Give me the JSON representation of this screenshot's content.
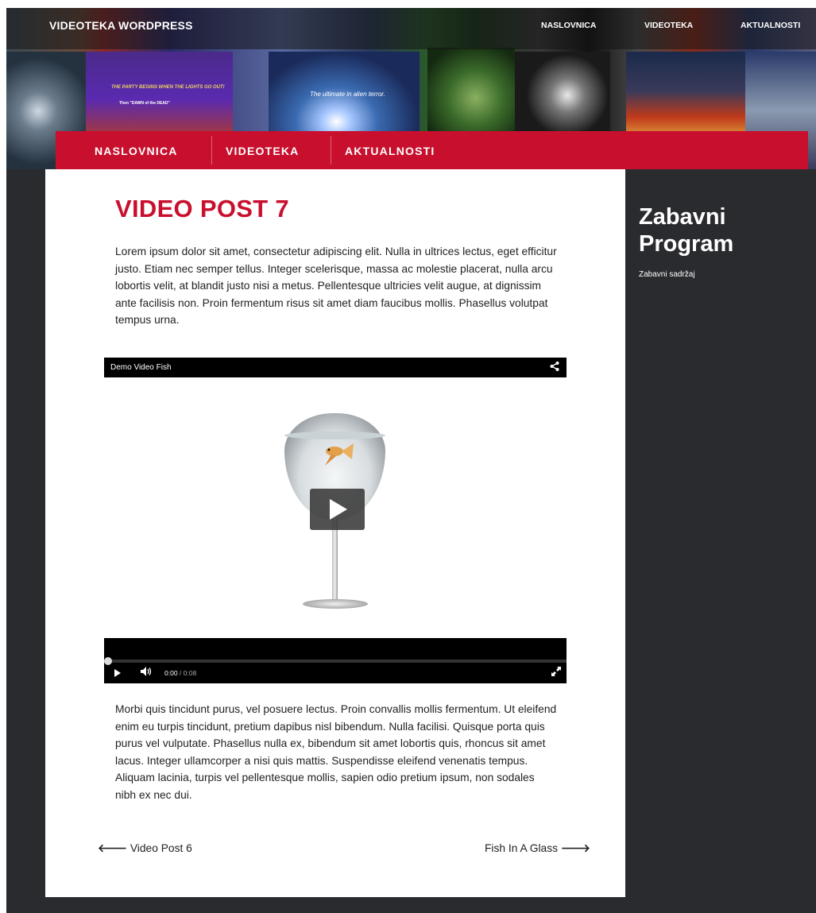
{
  "header": {
    "site_title": "VIDEOTEKA WORDPRESS",
    "top_nav": [
      "NASLOVNICA",
      "VIDEOTEKA",
      "AKTUALNOSTI"
    ],
    "poster_texts": [
      "THE PARTY BEGINS WHEN THE LIGHTS GO OUT!",
      "Then \"DAWN of the DEAD\"",
      "The ultimate in alien terror."
    ]
  },
  "main_nav": [
    "NASLOVNICA",
    "VIDEOTEKA",
    "AKTUALNOSTI"
  ],
  "post": {
    "title": "VIDEO POST 7",
    "paragraph_1": "Lorem ipsum dolor sit amet, consectetur adipiscing elit. Nulla in ultrices lectus, eget efficitur justo. Etiam nec semper tellus. Integer scelerisque, massa ac molestie placerat, nulla arcu lobortis velit, at blandit justo nisi a metus. Pellentesque ultricies velit augue, at dignissim ante facilisis non. Proin fermentum risus sit amet diam faucibus mollis. Phasellus volutpat tempus urna.",
    "paragraph_2": "Morbi quis tincidunt purus, vel posuere lectus. Proin convallis mollis fermentum. Ut eleifend enim eu turpis tincidunt, pretium dapibus nisl bibendum. Nulla facilisi. Quisque porta quis purus vel vulputate. Phasellus nulla ex, bibendum sit amet lobortis quis, rhoncus sit amet lacus. Integer ullamcorper a nisi quis mattis. Suspendisse eleifend venenatis tempus. Aliquam lacinia, turpis vel pellentesque mollis, sapien odio pretium ipsum, non sodales nibh ex nec dui."
  },
  "video": {
    "title": "Demo Video Fish",
    "current_time": "0:00",
    "duration": "/ 0:08",
    "progress": 0,
    "icons": [
      "share-icon",
      "play-icon",
      "volume-icon",
      "fullscreen-icon"
    ]
  },
  "post_navigation": {
    "prev_label": "Video Post 6",
    "next_label": "Fish In A Glass",
    "prev_arrow": "🡐",
    "next_arrow": "🡒"
  },
  "sidebar": {
    "title": "Zabavni Program",
    "subtitle": "Zabavni sadržaj"
  },
  "colors": {
    "accent": "#c8102e",
    "background": "#2a2b2f",
    "content": "#ffffff"
  }
}
